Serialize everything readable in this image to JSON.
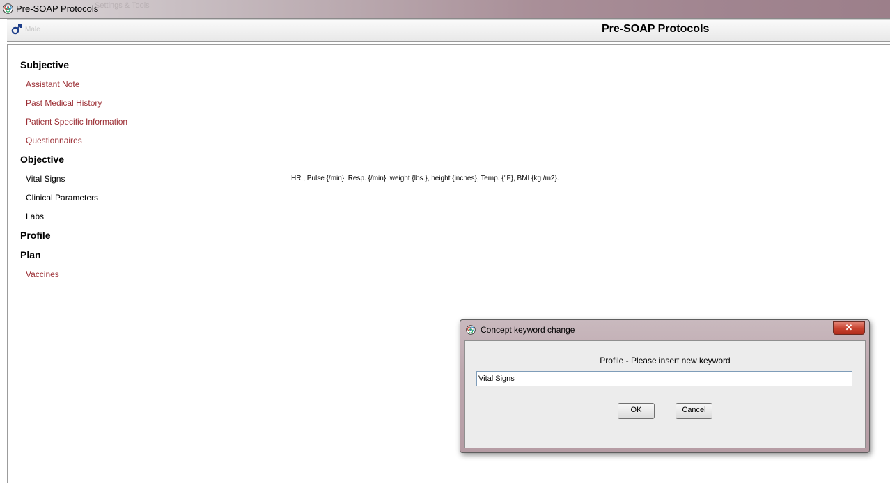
{
  "window": {
    "title": "Pre-SOAP Protocols",
    "ghost_title": "Settings & Tools"
  },
  "header": {
    "sex_icon": "male-icon",
    "sex_label": "Male",
    "page_title": "Pre-SOAP Protocols"
  },
  "sections": {
    "subjective": {
      "heading": "Subjective",
      "items": [
        "Assistant Note",
        "Past Medical History",
        "Patient Specific Information",
        "Questionnaires"
      ]
    },
    "objective": {
      "heading": "Objective",
      "items": [
        "Vital Signs",
        "Clinical Parameters",
        "Labs"
      ],
      "vital_signs_summary": "HR , Pulse {/min}, Resp. {/min}, weight {lbs.}, height {inches}, Temp. {°F}, BMI {kg./m2}."
    },
    "profile": {
      "heading": "Profile"
    },
    "plan": {
      "heading": "Plan",
      "items": [
        "Vaccines"
      ]
    }
  },
  "dialog": {
    "title": "Concept keyword change",
    "close_icon": "close-icon",
    "close_glyph": "✕",
    "prompt": "Profile - Please insert new keyword",
    "input_value": "Vital Signs",
    "ok_label": "OK",
    "cancel_label": "Cancel"
  },
  "colors": {
    "link": "#9b2d33",
    "close_button": "#c8422f"
  }
}
